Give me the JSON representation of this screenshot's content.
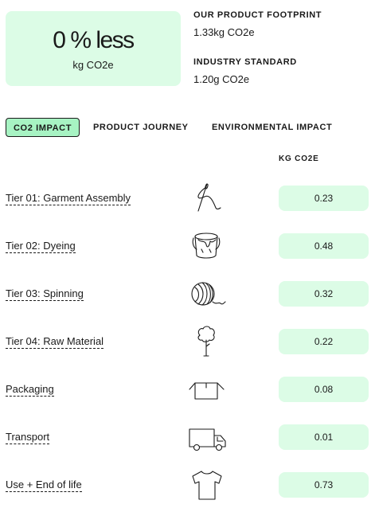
{
  "summary": {
    "value": "0 % less",
    "unit": "kg CO2e"
  },
  "product_footprint": {
    "label": "OUR PRODUCT FOOTPRINT",
    "value": "1.33kg CO2e"
  },
  "industry_standard": {
    "label": "INDUSTRY STANDARD",
    "value": "1.20g CO2e"
  },
  "tabs": [
    {
      "label": "CO2 IMPACT",
      "active": true
    },
    {
      "label": "PRODUCT JOURNEY",
      "active": false
    },
    {
      "label": "ENVIRONMENTAL IMPACT",
      "active": false
    }
  ],
  "table": {
    "value_header": "KG CO2E",
    "rows": [
      {
        "label": "Tier 01: Garment Assembly",
        "icon": "needle-thread-icon",
        "value": "0.23"
      },
      {
        "label": "Tier 02: Dyeing",
        "icon": "paint-bucket-icon",
        "value": "0.48"
      },
      {
        "label": "Tier 03: Spinning",
        "icon": "yarn-ball-icon",
        "value": "0.32"
      },
      {
        "label": "Tier 04: Raw Material",
        "icon": "cotton-plant-icon",
        "value": "0.22"
      },
      {
        "label": "Packaging",
        "icon": "box-icon",
        "value": "0.08"
      },
      {
        "label": "Transport",
        "icon": "truck-icon",
        "value": "0.01"
      },
      {
        "label": "Use + End of life",
        "icon": "tshirt-icon",
        "value": "0.73"
      }
    ]
  },
  "colors": {
    "light_green": "#dcfce6",
    "active_tab_green": "#a7f3c3",
    "text": "#1a1a1a"
  }
}
